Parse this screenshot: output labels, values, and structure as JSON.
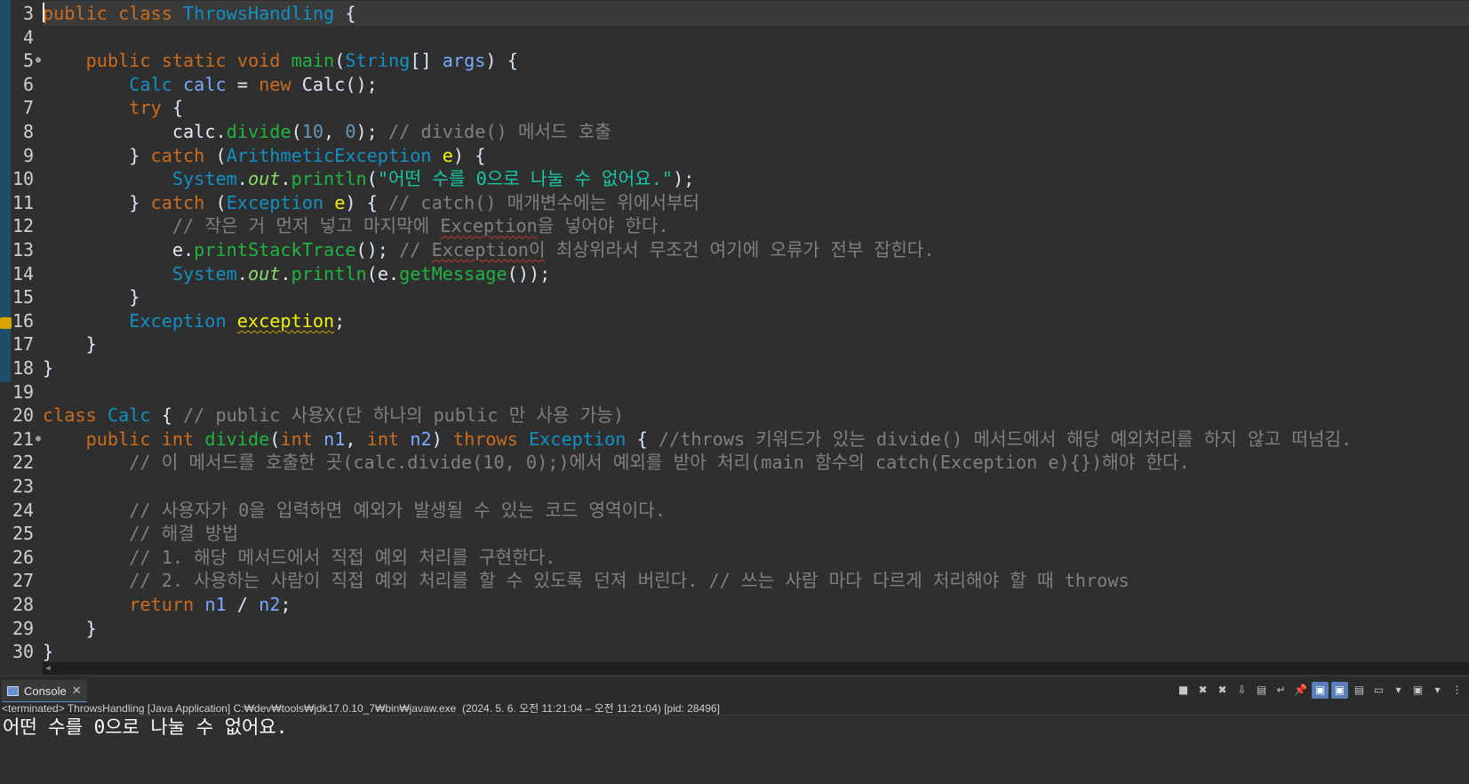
{
  "editor": {
    "lines": [
      {
        "no": "3",
        "tokens": [
          [
            "kw",
            "public"
          ],
          [
            "",
            " "
          ],
          [
            "kw",
            "class"
          ],
          [
            "",
            " "
          ],
          [
            "ty",
            "ThrowsHandling"
          ],
          [
            "",
            " {"
          ]
        ]
      },
      {
        "no": "4",
        "tokens": []
      },
      {
        "no": "5",
        "fold": true,
        "tokens": [
          [
            "",
            "    "
          ],
          [
            "kw",
            "public"
          ],
          [
            "",
            " "
          ],
          [
            "kw",
            "static"
          ],
          [
            "",
            " "
          ],
          [
            "kw",
            "void"
          ],
          [
            "",
            " "
          ],
          [
            "fn",
            "main"
          ],
          [
            "",
            "("
          ],
          [
            "ty",
            "String"
          ],
          [
            "",
            "[] "
          ],
          [
            "pr",
            "args"
          ],
          [
            "",
            ") {"
          ]
        ]
      },
      {
        "no": "6",
        "tokens": [
          [
            "",
            "        "
          ],
          [
            "ty",
            "Calc"
          ],
          [
            "",
            " "
          ],
          [
            "pr",
            "calc"
          ],
          [
            "",
            " = "
          ],
          [
            "kw",
            "new"
          ],
          [
            "",
            " "
          ],
          [
            "dl",
            "Calc"
          ],
          [
            "",
            "();"
          ]
        ]
      },
      {
        "no": "7",
        "tokens": [
          [
            "",
            "        "
          ],
          [
            "kw",
            "try"
          ],
          [
            "",
            " {"
          ]
        ]
      },
      {
        "no": "8",
        "tokens": [
          [
            "",
            "            "
          ],
          [
            "dl",
            "calc"
          ],
          [
            "",
            "."
          ],
          [
            "fn",
            "divide"
          ],
          [
            "",
            "("
          ],
          [
            "nm",
            "10"
          ],
          [
            "",
            ", "
          ],
          [
            "nm",
            "0"
          ],
          [
            "",
            "); "
          ],
          [
            "cm",
            "// divide() 메서드 호출"
          ]
        ]
      },
      {
        "no": "9",
        "tokens": [
          [
            "",
            "        } "
          ],
          [
            "kw",
            "catch"
          ],
          [
            "",
            " ("
          ],
          [
            "ty",
            "ArithmeticException"
          ],
          [
            "",
            " "
          ],
          [
            "lv",
            "e"
          ],
          [
            "",
            ") {"
          ]
        ]
      },
      {
        "no": "10",
        "tokens": [
          [
            "",
            "            "
          ],
          [
            "ty",
            "System"
          ],
          [
            "",
            "."
          ],
          [
            "sf",
            "out"
          ],
          [
            "",
            "."
          ],
          [
            "fn",
            "println"
          ],
          [
            "",
            "("
          ],
          [
            "st",
            "\"어떤 수를 0으로 나눌 수 없어요.\""
          ],
          [
            "",
            ");"
          ]
        ]
      },
      {
        "no": "11",
        "tokens": [
          [
            "",
            "        } "
          ],
          [
            "kw",
            "catch"
          ],
          [
            "",
            " ("
          ],
          [
            "ty",
            "Exception"
          ],
          [
            "",
            " "
          ],
          [
            "lv",
            "e"
          ],
          [
            "",
            ") { "
          ],
          [
            "cm",
            "// catch() 매개변수에는 위에서부터"
          ]
        ]
      },
      {
        "no": "12",
        "tokens": [
          [
            "",
            "            "
          ],
          [
            "cm",
            "// 작은 거 먼저 넣고 마지막에 "
          ],
          [
            "cm sq",
            "Exception"
          ],
          [
            "cm",
            "을 넣어야 한다."
          ]
        ]
      },
      {
        "no": "13",
        "tokens": [
          [
            "",
            "            "
          ],
          [
            "dl",
            "e"
          ],
          [
            "",
            "."
          ],
          [
            "fn",
            "printStackTrace"
          ],
          [
            "",
            "(); "
          ],
          [
            "cm",
            "// "
          ],
          [
            "cm sq",
            "Exception이"
          ],
          [
            "cm",
            " 최상위라서 무조건 여기에 오류가 전부 잡힌다."
          ]
        ]
      },
      {
        "no": "14",
        "tokens": [
          [
            "",
            "            "
          ],
          [
            "ty",
            "System"
          ],
          [
            "",
            "."
          ],
          [
            "sf",
            "out"
          ],
          [
            "",
            "."
          ],
          [
            "fn",
            "println"
          ],
          [
            "",
            "("
          ],
          [
            "dl",
            "e"
          ],
          [
            "",
            "."
          ],
          [
            "fn",
            "getMessage"
          ],
          [
            "",
            "());"
          ]
        ]
      },
      {
        "no": "15",
        "tokens": [
          [
            "",
            "        }"
          ]
        ]
      },
      {
        "no": "16",
        "tokens": [
          [
            "",
            "        "
          ],
          [
            "ty",
            "Exception"
          ],
          [
            "",
            " "
          ],
          [
            "lv sqy",
            "exception"
          ],
          [
            "",
            ";"
          ]
        ]
      },
      {
        "no": "17",
        "tokens": [
          [
            "",
            "    }"
          ]
        ]
      },
      {
        "no": "18",
        "tokens": [
          [
            "",
            "}"
          ]
        ]
      },
      {
        "no": "19",
        "tokens": []
      },
      {
        "no": "20",
        "tokens": [
          [
            "kw",
            "class"
          ],
          [
            "",
            " "
          ],
          [
            "ty",
            "Calc"
          ],
          [
            "",
            " { "
          ],
          [
            "cm",
            "// public 사용X(단 하나의 public 만 사용 가능)"
          ]
        ]
      },
      {
        "no": "21",
        "fold": true,
        "tokens": [
          [
            "",
            "    "
          ],
          [
            "kw",
            "public"
          ],
          [
            "",
            " "
          ],
          [
            "kw",
            "int"
          ],
          [
            "",
            " "
          ],
          [
            "fn",
            "divide"
          ],
          [
            "",
            "("
          ],
          [
            "kw",
            "int"
          ],
          [
            "",
            " "
          ],
          [
            "pr",
            "n1"
          ],
          [
            "",
            ", "
          ],
          [
            "kw",
            "int"
          ],
          [
            "",
            " "
          ],
          [
            "pr",
            "n2"
          ],
          [
            "",
            ") "
          ],
          [
            "kw",
            "throws"
          ],
          [
            "",
            " "
          ],
          [
            "ty",
            "Exception"
          ],
          [
            "",
            " { "
          ],
          [
            "cm",
            "//throws 키워드가 있는 divide() 메서드에서 해당 예외처리를 하지 않고 떠넘김."
          ]
        ]
      },
      {
        "no": "22",
        "tokens": [
          [
            "",
            "        "
          ],
          [
            "cm",
            "// 이 메서드를 호출한 곳(calc.divide(10, 0);)에서 예외를 받아 처리(main 함수의 catch(Exception e){})해야 한다."
          ]
        ]
      },
      {
        "no": "23",
        "tokens": []
      },
      {
        "no": "24",
        "tokens": [
          [
            "",
            "        "
          ],
          [
            "cm",
            "// 사용자가 0을 입력하면 예외가 발생될 수 있는 코드 영역이다."
          ]
        ]
      },
      {
        "no": "25",
        "tokens": [
          [
            "",
            "        "
          ],
          [
            "cm",
            "// 해결 방법"
          ]
        ]
      },
      {
        "no": "26",
        "tokens": [
          [
            "",
            "        "
          ],
          [
            "cm",
            "// 1. 해당 메서드에서 직접 예외 처리를 구현한다."
          ]
        ]
      },
      {
        "no": "27",
        "tokens": [
          [
            "",
            "        "
          ],
          [
            "cm",
            "// 2. 사용하는 사람이 직접 예외 처리를 할 수 있도록 던져 버린다. // 쓰는 사람 마다 다르게 처리해야 할 때 throws"
          ]
        ]
      },
      {
        "no": "28",
        "tokens": [
          [
            "",
            "        "
          ],
          [
            "kw",
            "return"
          ],
          [
            "",
            " "
          ],
          [
            "pr",
            "n1"
          ],
          [
            "",
            " / "
          ],
          [
            "pr",
            "n2"
          ],
          [
            "",
            ";"
          ]
        ]
      },
      {
        "no": "29",
        "tokens": [
          [
            "",
            "    }"
          ]
        ]
      },
      {
        "no": "30",
        "tokens": [
          [
            "",
            "}"
          ]
        ]
      }
    ]
  },
  "console": {
    "tab_label": "Console",
    "process_line": "<terminated> ThrowsHandling [Java Application] C:₩dev₩tools₩jdk17.0.10_7₩bin₩javaw.exe  (2024. 5. 6. 오전 11:21:04 – 오전 11:21:04) [pid: 28496]",
    "output_lines": [
      "어떤 수를 0으로 나눌 수 없어요."
    ],
    "toolbar_icons": [
      "terminate-icon",
      "remove-launch-icon",
      "remove-all-terminated-icon",
      "scroll-lock-icon",
      "show-console-icon",
      "word-wrap-icon",
      "pin-console-icon",
      "show-stdout-icon",
      "show-stderr-icon",
      "open-console-icon",
      "display-selected-console-icon",
      "console-dropdown-icon",
      "new-console-icon",
      "new-console-dropdown-icon",
      "view-menu-icon"
    ]
  },
  "colors": {
    "background": "#2f2f2f",
    "keyword": "#cc6c1d",
    "type": "#1290c3",
    "method": "#1eb540",
    "comment": "#808080",
    "string": "#17c6a3",
    "number": "#6897bb",
    "parameter": "#79abff",
    "static_field": "#8dda6e",
    "local_var": "#f2f200"
  }
}
